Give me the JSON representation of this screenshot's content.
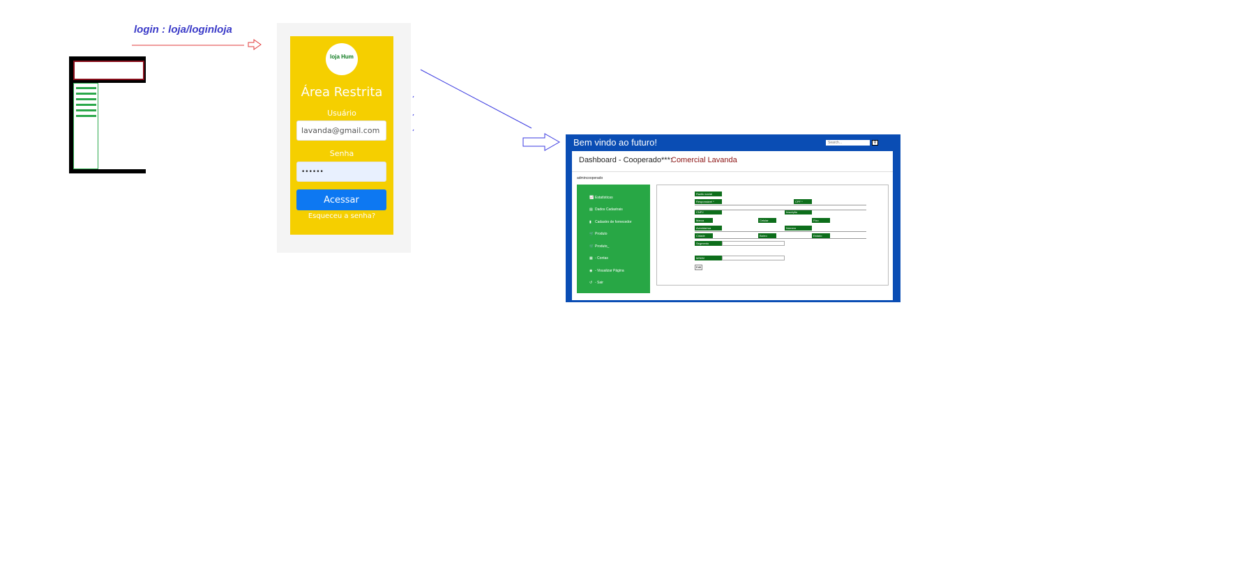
{
  "annotation": {
    "label": "login : loja/loginloja"
  },
  "login": {
    "logo_text": "loja Hum",
    "title": "Área Restrita",
    "user_label": "Usuário",
    "user_value": "lavanda@gmail.com",
    "password_label": "Senha",
    "password_value": "••••••",
    "submit_label": "Acessar",
    "forgot_label": "Esqueceu a senha?"
  },
  "dashboard": {
    "welcome": "Bem vindo ao futuro!",
    "search_placeholder": "Search...",
    "search_icon": "search-icon",
    "title": "Dashboard - Cooperado***:",
    "store_name": "Comercial Lavanda",
    "user": "admincooperado",
    "menu": [
      {
        "icon": "chart-icon",
        "label": "Estatísticas"
      },
      {
        "icon": "card-icon",
        "label": "Dados Cadastrais"
      },
      {
        "icon": "bar-chart-icon",
        "label": "Cadastro de fornecedor"
      },
      {
        "icon": "cart-icon",
        "label": "Produto"
      },
      {
        "icon": "cart-icon",
        "label": "Produto_"
      },
      {
        "icon": "calculator-icon",
        "label": "- Contas"
      },
      {
        "icon": "eye-icon",
        "label": "- Visualizar Página"
      },
      {
        "icon": "undo-icon",
        "label": "- Sair"
      }
    ],
    "form": {
      "fields": [
        "Razão social",
        "Responsável *",
        "CPF *",
        "CNPJ",
        "Inscrição",
        "Marca",
        "Celular",
        "Fixo",
        "Avenida/rua",
        "Número",
        "Cidade",
        "Bairro",
        "Estado",
        "Segmento",
        "MINIM"
      ],
      "edit_label": "Edit"
    }
  },
  "colors": {
    "login_card": "#f5cf00",
    "dashboard_frame": "#0a4db4",
    "menu": "#28a745",
    "field_label": "#0d6e1b",
    "store_name": "#8a1010"
  }
}
